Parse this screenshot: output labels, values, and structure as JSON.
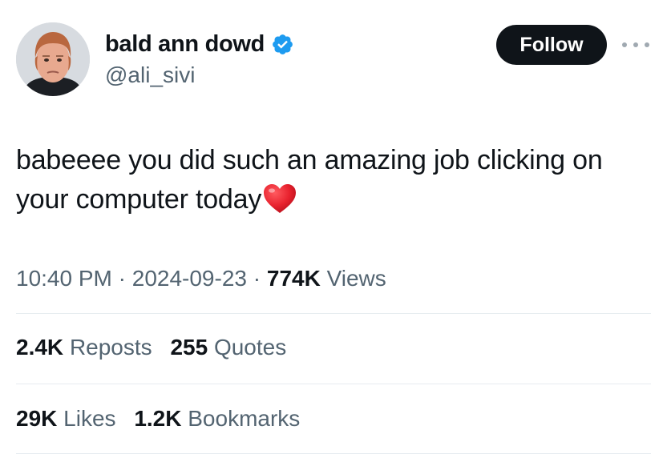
{
  "author": {
    "display_name": "bald ann dowd",
    "handle": "@ali_sivi",
    "verified": true,
    "avatar_icon": "profile-photo"
  },
  "actions": {
    "follow_label": "Follow",
    "more_icon": "ellipsis-icon"
  },
  "tweet": {
    "text": "babeeee you did such an amazing job clicking on your computer today",
    "emoji": "red-heart"
  },
  "meta": {
    "time": "10:40 PM",
    "separator": "·",
    "date": "2024-09-23",
    "views_count": "774K",
    "views_label": "Views"
  },
  "stats": {
    "reposts_count": "2.4K",
    "reposts_label": "Reposts",
    "quotes_count": "255",
    "quotes_label": "Quotes",
    "likes_count": "29K",
    "likes_label": "Likes",
    "bookmarks_count": "1.2K",
    "bookmarks_label": "Bookmarks"
  },
  "colors": {
    "text_primary": "#0f1419",
    "text_secondary": "#536471",
    "verified_blue": "#1d9bf0",
    "follow_button_bg": "#0f1419",
    "divider": "#e6ecf0"
  }
}
